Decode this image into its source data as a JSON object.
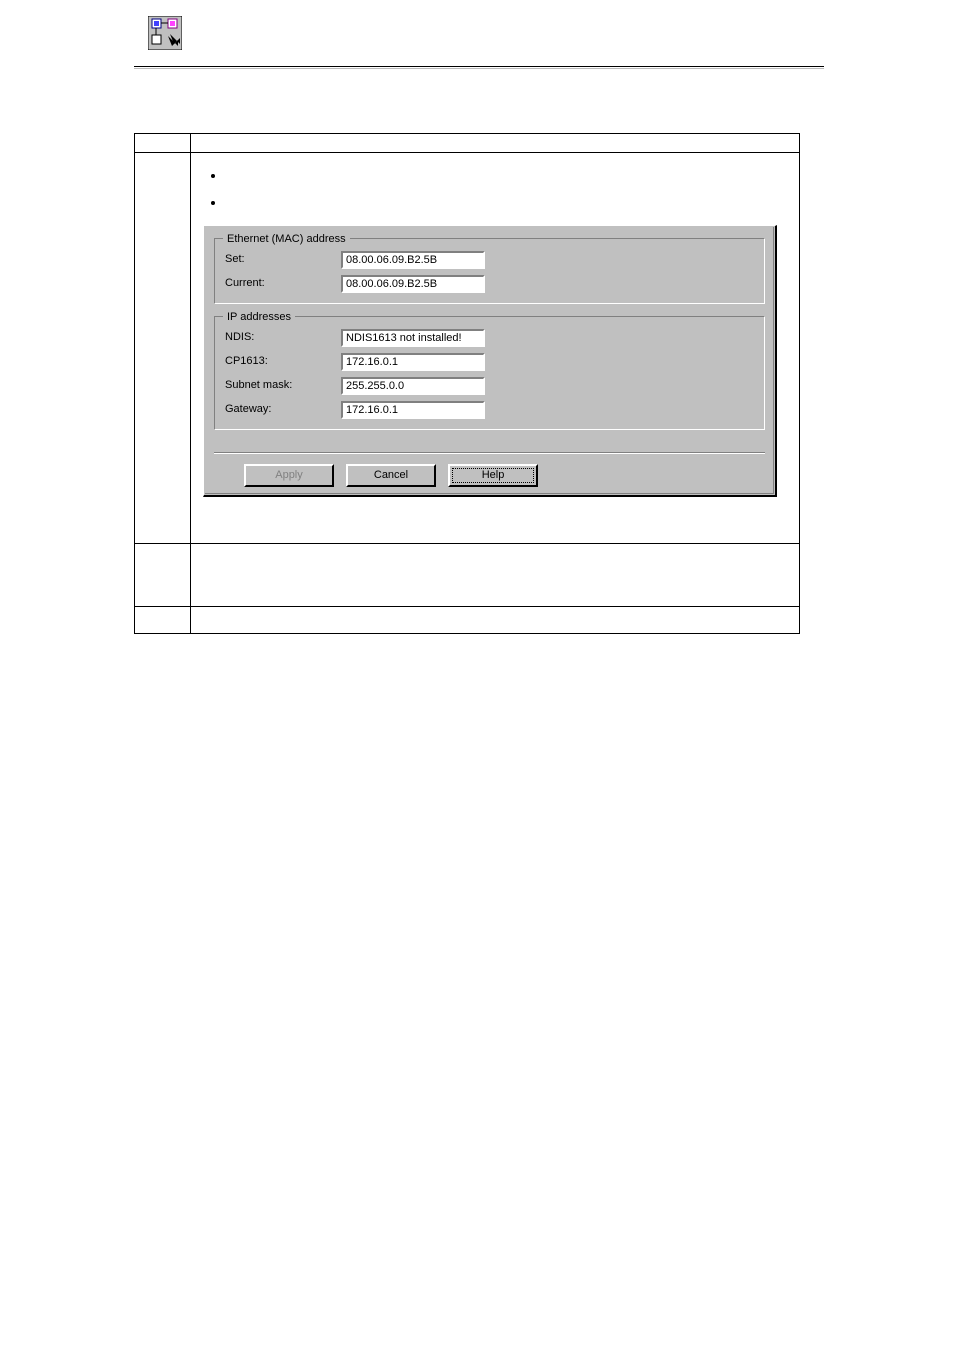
{
  "row2": {
    "intro": "",
    "bullets": [
      "",
      ""
    ]
  },
  "dialog": {
    "mac": {
      "title": "Ethernet (MAC) address",
      "set_label": "Set:",
      "set_value": "08.00.06.09.B2.5B",
      "current_label": "Current:",
      "current_value": "08.00.06.09.B2.5B"
    },
    "ip": {
      "title": "IP addresses",
      "ndis_label": "NDIS:",
      "ndis_value": "NDIS1613 not installed!",
      "cp1613_label": "CP1613:",
      "cp1613_value": "172.16.0.1",
      "subnet_label": "Subnet mask:",
      "subnet_value": "255.255.0.0",
      "gateway_label": "Gateway:",
      "gateway_value": "172.16.0.1"
    },
    "buttons": {
      "apply": "Apply",
      "cancel": "Cancel",
      "help": "Help"
    }
  }
}
